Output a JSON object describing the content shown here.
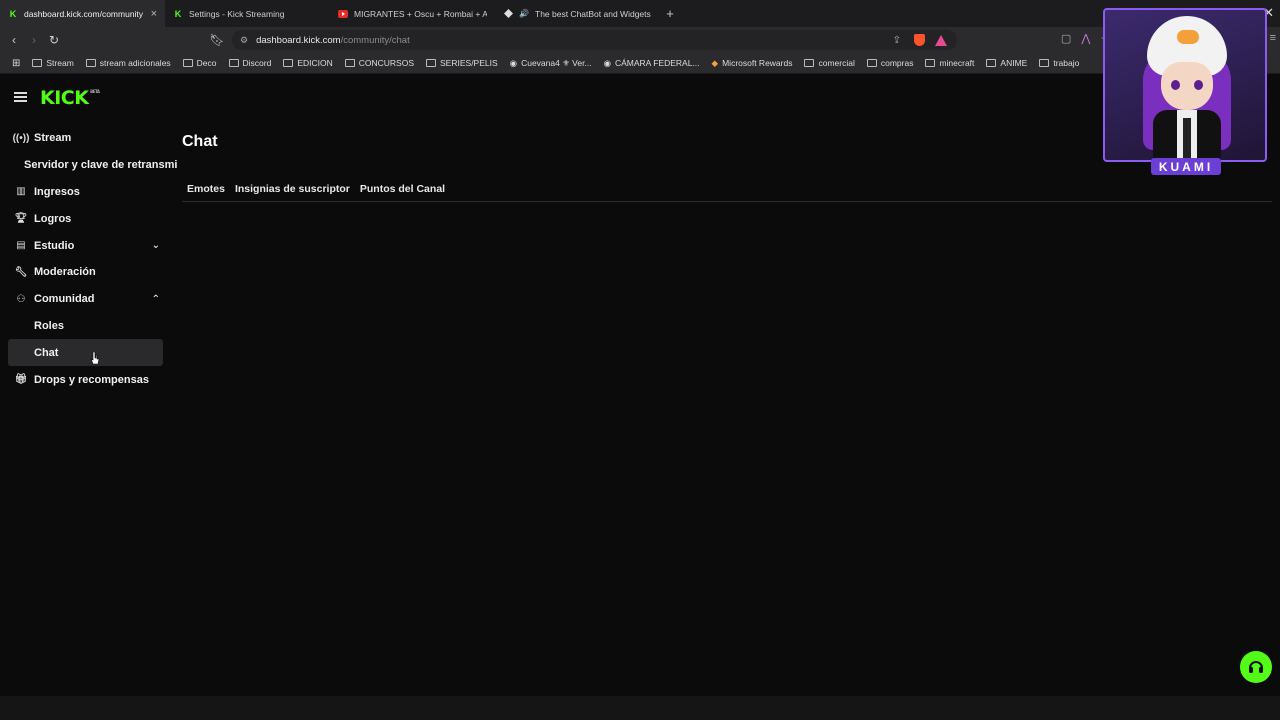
{
  "browser": {
    "tabs": [
      {
        "title": "dashboard.kick.com/community",
        "favicon": "kick-icon",
        "active": true
      },
      {
        "title": "Settings - Kick Streaming",
        "favicon": "kick-icon",
        "active": false
      },
      {
        "title": "MIGRANTES + Oscu + Rombai + AG",
        "favicon": "youtube-icon",
        "active": false
      },
      {
        "title": "The best ChatBot and Widgets fo",
        "favicon": "botrix-icon",
        "active": false
      }
    ],
    "new_tab": "+",
    "url_host": "dashboard.kick.com",
    "url_path": "/community/chat",
    "bookmarks": [
      {
        "label": "Stream"
      },
      {
        "label": "stream adicionales"
      },
      {
        "label": "Deco"
      },
      {
        "label": "Discord"
      },
      {
        "label": "EDICION"
      },
      {
        "label": "CONCURSOS"
      },
      {
        "label": "SERIES/PELIS"
      },
      {
        "label": "Cuevana4 ⚜ Ver..."
      },
      {
        "label": "CÁMARA FEDERAL..."
      },
      {
        "label": "Microsoft Rewards"
      },
      {
        "label": "comercial"
      },
      {
        "label": "compras"
      },
      {
        "label": "minecraft"
      },
      {
        "label": "ANIME"
      },
      {
        "label": "trabajo"
      }
    ]
  },
  "brand": {
    "logo": "KICK",
    "badge": "BETA",
    "accent": "#53fc18"
  },
  "sidebar": {
    "items": [
      {
        "label": "Stream",
        "icon": "broadcast-icon"
      },
      {
        "label": "Servidor y clave de retransmisión"
      },
      {
        "label": "Ingresos",
        "icon": "chart-icon"
      },
      {
        "label": "Logros",
        "icon": "trophy-icon"
      },
      {
        "label": "Estudio",
        "icon": "studio-icon"
      },
      {
        "label": "Moderación",
        "icon": "wrench-icon"
      },
      {
        "label": "Comunidad",
        "icon": "community-icon"
      },
      {
        "label": "Roles"
      },
      {
        "label": "Chat"
      },
      {
        "label": "Drops y recompensas",
        "icon": "gift-icon"
      }
    ]
  },
  "main": {
    "title": "Chat",
    "tabs": [
      "Emotes",
      "Insignias de suscriptor",
      "Puntos del Canal"
    ]
  },
  "overlay": {
    "name": "KUAMI"
  }
}
